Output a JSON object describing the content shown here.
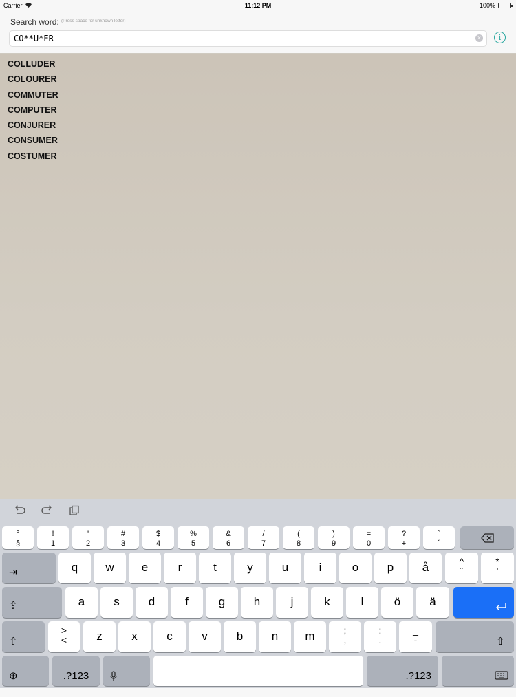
{
  "status_bar": {
    "carrier": "Carrier",
    "time": "11:12 PM",
    "battery": "100%"
  },
  "search": {
    "label": "Search word:",
    "hint": "(Press space for unknown letter)",
    "value": "CO**U*ER"
  },
  "results": [
    "COLLUDER",
    "COLOURER",
    "COMMUTER",
    "COMPUTER",
    "CONJURER",
    "CONSUMER",
    "COSTUMER"
  ],
  "keyboard": {
    "shortcut_icons": [
      "undo-icon",
      "redo-icon",
      "paste-icon"
    ],
    "number_row": [
      {
        "top": "°",
        "bottom": "§"
      },
      {
        "top": "!",
        "bottom": "1"
      },
      {
        "top": "\"",
        "bottom": "2"
      },
      {
        "top": "#",
        "bottom": "3"
      },
      {
        "top": "$",
        "bottom": "4"
      },
      {
        "top": "%",
        "bottom": "5"
      },
      {
        "top": "&",
        "bottom": "6"
      },
      {
        "top": "/",
        "bottom": "7"
      },
      {
        "top": "(",
        "bottom": "8"
      },
      {
        "top": ")",
        "bottom": "9"
      },
      {
        "top": "=",
        "bottom": "0"
      },
      {
        "top": "?",
        "bottom": "+"
      },
      {
        "top": "`",
        "bottom": "´"
      }
    ],
    "row1": [
      "q",
      "w",
      "e",
      "r",
      "t",
      "y",
      "u",
      "i",
      "o",
      "p",
      "å"
    ],
    "row1_extra": [
      {
        "top": "^",
        "bottom": "¨"
      },
      {
        "top": "*",
        "bottom": "'"
      }
    ],
    "row2": [
      "a",
      "s",
      "d",
      "f",
      "g",
      "h",
      "j",
      "k",
      "l",
      "ö",
      "ä"
    ],
    "row3_first": {
      "top": ">",
      "bottom": "<"
    },
    "row3": [
      "z",
      "x",
      "c",
      "v",
      "b",
      "n",
      "m"
    ],
    "row3_punct": [
      {
        "top": ";",
        "bottom": ","
      },
      {
        "top": ":",
        "bottom": "."
      },
      {
        "top": "_",
        "bottom": "-"
      }
    ],
    "numbers_label": ".?123",
    "colors": {
      "return_key": "#1a6ff7",
      "key": "#ffffff",
      "special_key": "#acb1ba"
    }
  }
}
